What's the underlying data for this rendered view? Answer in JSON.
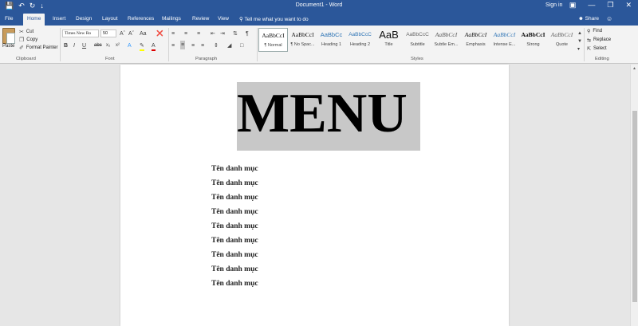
{
  "window": {
    "doc_title": "Document1 - Word",
    "sign_in": "Sign in",
    "qa_icons": [
      "save-icon",
      "undo-icon",
      "redo-icon",
      "customize-icon"
    ],
    "win_icons": [
      "ribbon-options-icon",
      "minimize-icon",
      "restore-icon",
      "close-icon"
    ]
  },
  "tabs": [
    "File",
    "Home",
    "Insert",
    "Design",
    "Layout",
    "References",
    "Mailings",
    "Review",
    "View"
  ],
  "active_tab": "Home",
  "tell_me": "Tell me what you want to do",
  "share": "Share",
  "clipboard": {
    "paste": "Paste",
    "cut": "Cut",
    "copy": "Copy",
    "format_painter": "Format Painter",
    "label": "Clipboard"
  },
  "font": {
    "name": "Times New Ro",
    "size": "50",
    "label": "Font"
  },
  "paragraph_label": "Paragraph",
  "styles": {
    "label": "Styles",
    "items": [
      {
        "sample": "AaBbCcI",
        "name": "¶ Normal"
      },
      {
        "sample": "AaBbCcI",
        "name": "¶ No Spac..."
      },
      {
        "sample": "AaBbCc",
        "name": "Heading 1"
      },
      {
        "sample": "AaBbCcC",
        "name": "Heading 2"
      },
      {
        "sample": "AaB",
        "name": "Title"
      },
      {
        "sample": "AaBbCcC",
        "name": "Subtitle"
      },
      {
        "sample": "AaBbCcI",
        "name": "Subtle Em..."
      },
      {
        "sample": "AaBbCcI",
        "name": "Emphasis"
      },
      {
        "sample": "AaBbCcI",
        "name": "Intense E..."
      },
      {
        "sample": "AaBbCcI",
        "name": "Strong"
      },
      {
        "sample": "AaBbCcI",
        "name": "Quote"
      }
    ]
  },
  "editing": {
    "find": "Find",
    "replace": "Replace",
    "select": "Select",
    "label": "Editing"
  },
  "document": {
    "heading": "MENU",
    "heading_bg": "#c8c8c8",
    "items": [
      "Tên danh mục",
      "Tên danh mục",
      "Tên danh mục",
      "Tên danh mục",
      "Tên danh mục",
      "Tên danh mục",
      "Tên danh mục",
      "Tên danh mục",
      "Tên danh mục"
    ]
  },
  "colors": {
    "brand": "#2b579a",
    "ribbon": "#f3f3f3"
  }
}
